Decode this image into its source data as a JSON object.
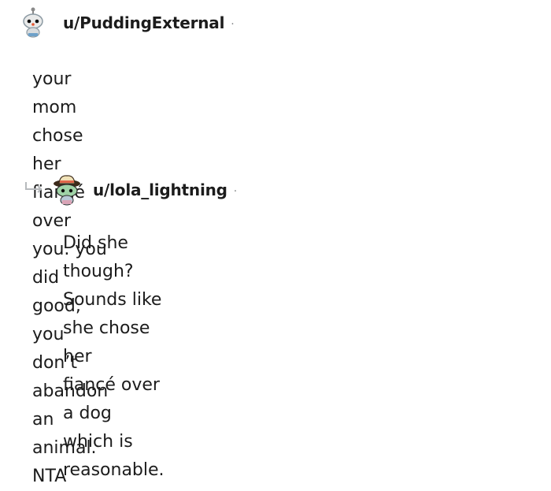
{
  "comments": [
    {
      "username": "u/PuddingExternal",
      "separator": "·",
      "text": "your mom chose her fiancé over you. you did good,\nyou don’t abandon an animal. NTA",
      "avatar_icon": "snoo-avatar-icon"
    },
    {
      "username": "u/lola_lightning",
      "separator": "·",
      "text": "Did she though? Sounds like she chose her\nfiancé over a dog which is reasonable.",
      "avatar_icon": "snoo-hat-avatar-icon",
      "reply_icon": "reply-arrow-icon"
    }
  ],
  "colors": {
    "text": "#1c1c1c",
    "meta": "#878a8c"
  }
}
